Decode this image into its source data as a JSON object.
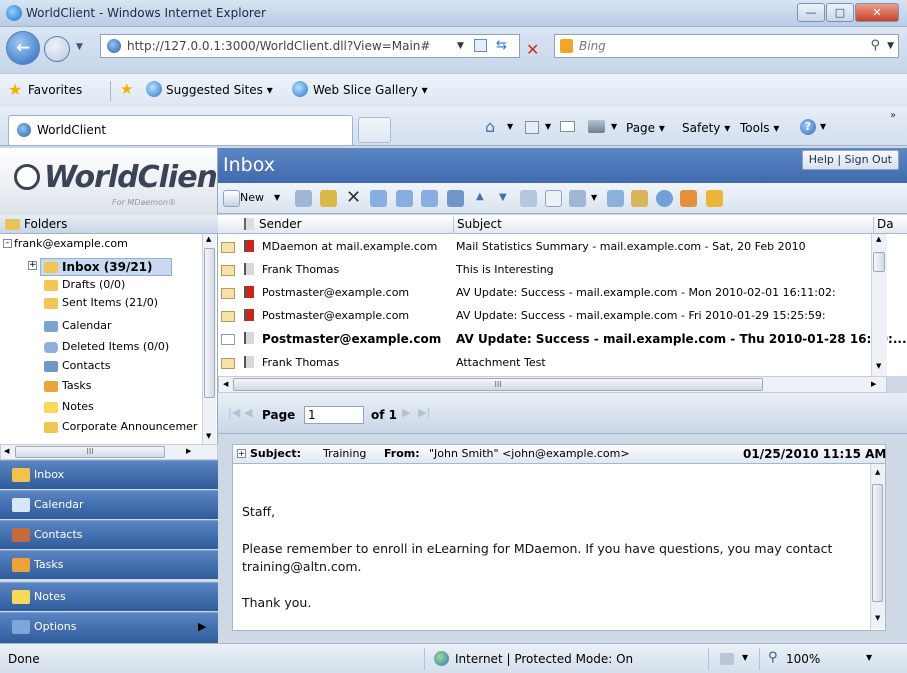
{
  "window": {
    "title": "WorldClient - Windows Internet Explorer"
  },
  "address": {
    "url": "http://127.0.0.1:3000/WorldClient.dll?View=Main#",
    "search_placeholder": "Bing"
  },
  "favorites": {
    "label": "Favorites",
    "suggested": "Suggested Sites ▾",
    "webslice": "Web Slice Gallery ▾"
  },
  "tab": {
    "title": "WorldClient"
  },
  "commands": {
    "page": "Page ▾",
    "safety": "Safety ▾",
    "tools": "Tools ▾"
  },
  "app": {
    "logo": "WorldClient",
    "logo_sub": "For MDaemon®",
    "header_title": "Inbox",
    "help_signout": "Help | Sign Out",
    "new_label": "New"
  },
  "folders": {
    "header": "Folders",
    "account": "frank@example.com",
    "items": [
      {
        "label": "Inbox (39/21)",
        "bold": true
      },
      {
        "label": "Drafts (0/0)"
      },
      {
        "label": "Sent Items (21/0)"
      },
      {
        "label": "Calendar"
      },
      {
        "label": "Deleted Items (0/0)"
      },
      {
        "label": "Contacts"
      },
      {
        "label": "Tasks"
      },
      {
        "label": "Notes"
      },
      {
        "label": "Corporate Announcemer"
      }
    ],
    "hscroll_thumb": "III"
  },
  "nav": [
    {
      "label": "Inbox",
      "icon": "inbox-icon",
      "color": "#f3c24a"
    },
    {
      "label": "Calendar",
      "icon": "calendar-icon",
      "color": "#d9e6f7"
    },
    {
      "label": "Contacts",
      "icon": "contacts-icon",
      "color": "#c46a3c"
    },
    {
      "label": "Tasks",
      "icon": "tasks-icon",
      "color": "#f0a23a"
    },
    {
      "label": "Notes",
      "icon": "notes-icon",
      "color": "#f7d85a"
    },
    {
      "label": "Options",
      "icon": "options-icon",
      "color": "#7fa6d8"
    }
  ],
  "list": {
    "columns": {
      "sender": "Sender",
      "subject": "Subject",
      "date": "Da"
    },
    "rows": [
      {
        "sender": "MDaemon at mail.example.com",
        "subject": "Mail Statistics Summary - mail.example.com - Sat, 20 Feb 2010",
        "flag": "red",
        "bold": false
      },
      {
        "sender": "Frank Thomas",
        "subject": "This is Interesting",
        "flag": "gray",
        "bold": false
      },
      {
        "sender": "Postmaster@example.com",
        "subject": "AV Update: Success - mail.example.com - Mon 2010-02-01 16:11:02:",
        "flag": "red",
        "bold": false
      },
      {
        "sender": "Postmaster@example.com",
        "subject": "AV Update: Success - mail.example.com - Fri 2010-01-29 15:25:59:",
        "flag": "red",
        "bold": false
      },
      {
        "sender": "Postmaster@example.com",
        "subject": "AV Update: Success - mail.example.com - Thu 2010-01-28 16:10:...",
        "flag": "gray",
        "bold": true
      },
      {
        "sender": "Frank Thomas",
        "subject": "Attachment Test",
        "flag": "gray",
        "bold": false
      }
    ],
    "hscroll_thumb": "III",
    "pager": {
      "page_label": "Page",
      "page_value": "1",
      "of_label": "of 1"
    }
  },
  "preview": {
    "subject_label": "Subject:",
    "subject": "Training",
    "from_label": "From:",
    "from": "\"John Smith\" <john@example.com>",
    "date": "01/25/2010 11:15 AM",
    "body": [
      "Staff,",
      "Please remember to enroll in eLearning for MDaemon. If you have questions, you may contact training@altn.com.",
      "Thank you."
    ]
  },
  "status": {
    "left": "Done",
    "zone": "Internet | Protected Mode: On",
    "zoom": "100%"
  }
}
